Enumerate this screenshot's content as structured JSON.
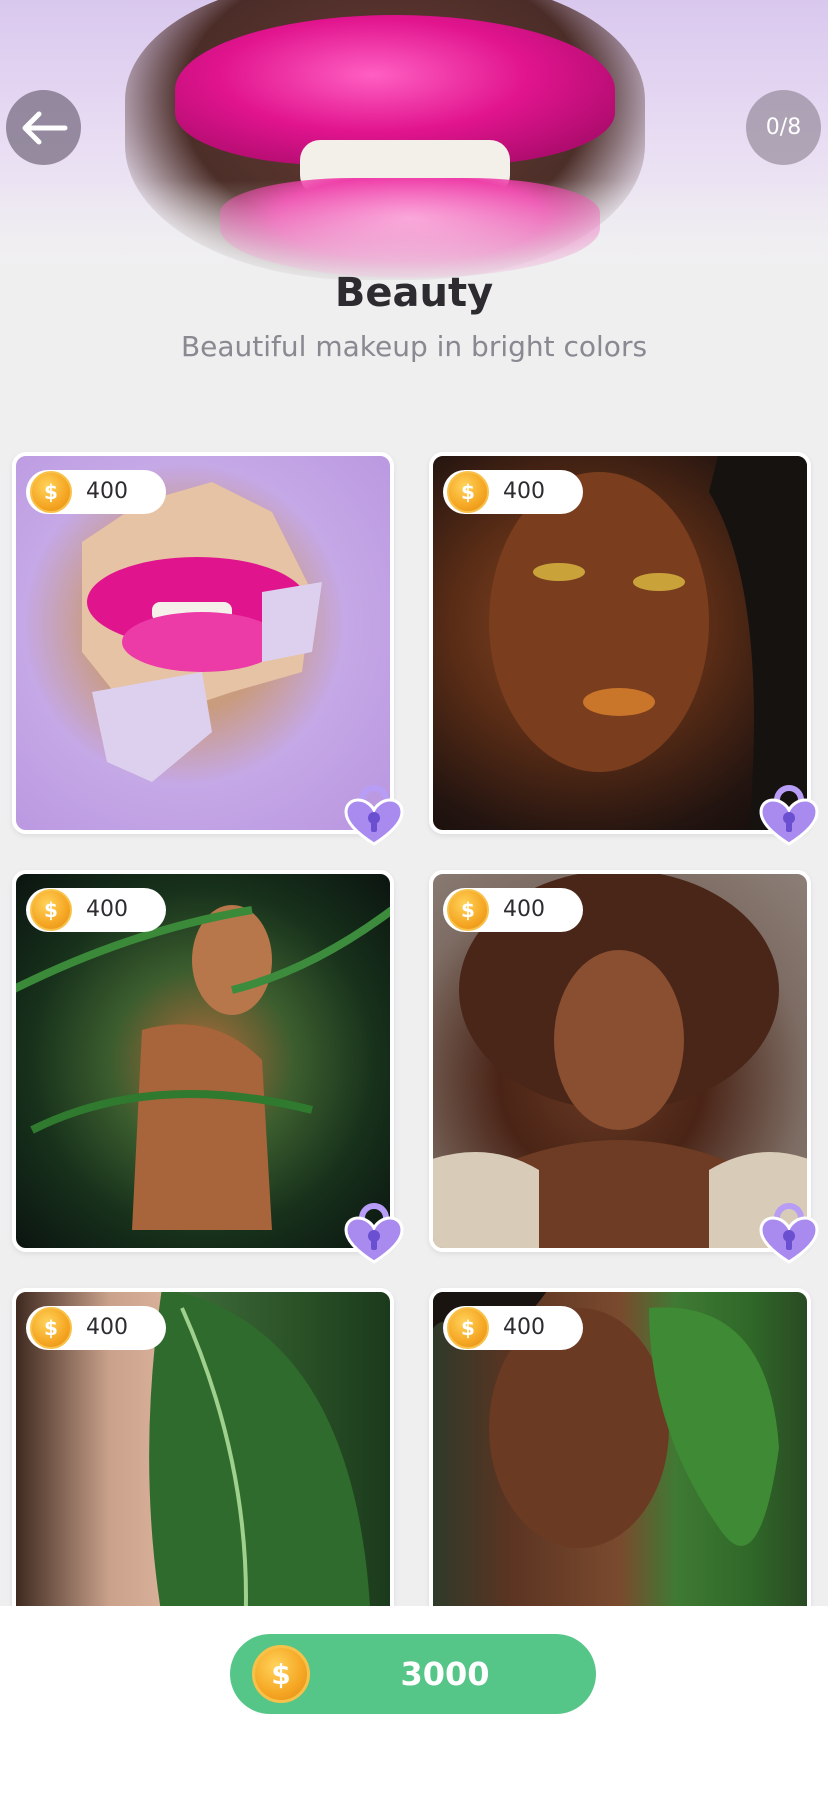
{
  "header": {
    "progress": "0/8",
    "title": "Beauty",
    "subtitle": "Beautiful makeup in bright colors"
  },
  "coin_symbol": "$",
  "cards": [
    {
      "price": "400",
      "locked": true,
      "image": "pink-lips-torn-paper"
    },
    {
      "price": "400",
      "locked": true,
      "image": "woman-gold-eyeshadow-braids"
    },
    {
      "price": "400",
      "locked": true,
      "image": "woman-in-palm-leaves"
    },
    {
      "price": "400",
      "locked": true,
      "image": "woman-curly-hair"
    },
    {
      "price": "400",
      "locked": false,
      "image": "woman-with-leaf"
    },
    {
      "price": "400",
      "locked": false,
      "image": "woman-holding-leaf"
    }
  ],
  "wallet": {
    "coins": "3000"
  },
  "colors": {
    "accent_green": "#55c688",
    "lock_purple": "#a98bf0",
    "coin_gold": "#f5a623"
  },
  "icons": [
    "back-arrow-icon",
    "coin-icon",
    "lock-icon"
  ]
}
